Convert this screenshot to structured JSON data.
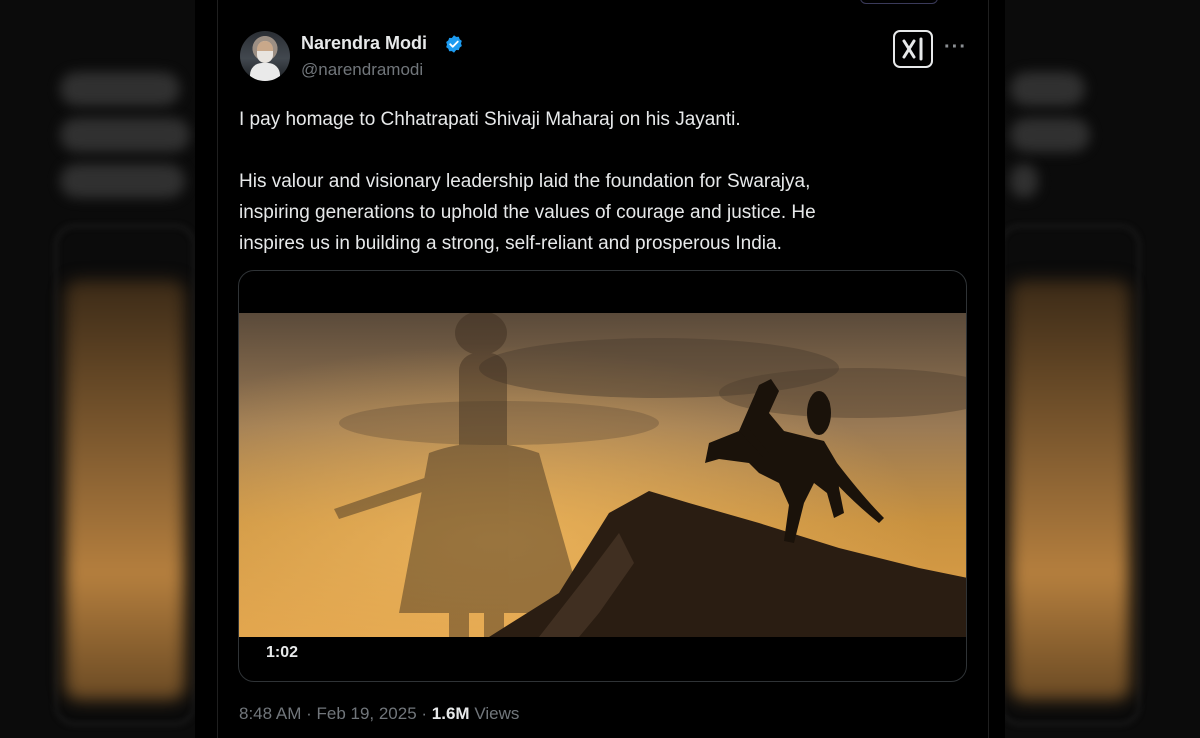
{
  "author": {
    "name": "Narendra Modi",
    "handle": "@narendramodi",
    "verified": true
  },
  "tweet": {
    "line1": "I pay homage to Chhatrapati Shivaji Maharaj on his Jayanti.",
    "line2": "His valour and visionary leadership laid the foundation for Swarajya,",
    "line3": "inspiring generations to uphold the values of courage and justice. He",
    "line4": "inspires us in building a strong, self-reliant and prosperous India."
  },
  "media": {
    "type": "video",
    "duration": "1:02"
  },
  "meta": {
    "time": "8:48 AM",
    "separator": " · ",
    "date": "Feb 19, 2025",
    "views_count": "1.6M",
    "views_label": "Views"
  },
  "icons": {
    "verified": "verified-badge-icon",
    "grok": "grok-icon",
    "more": "more-icon"
  },
  "colors": {
    "background": "#000000",
    "text": "#e7e9ea",
    "muted": "#71767b",
    "verified": "#1d9bf0"
  }
}
